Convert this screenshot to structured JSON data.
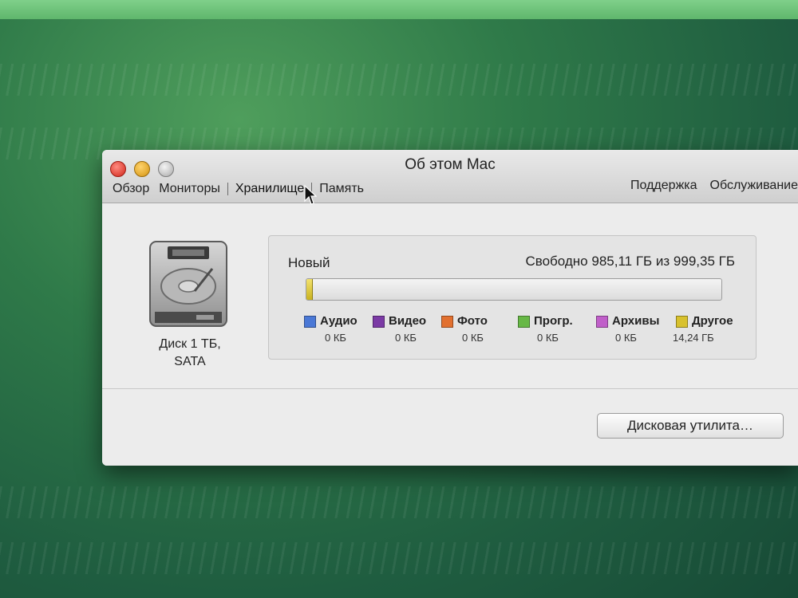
{
  "window": {
    "title": "Об этом Mac",
    "tabs": [
      {
        "label": "Обзор"
      },
      {
        "label": "Мониторы"
      },
      {
        "label": "Хранилище"
      },
      {
        "label": "Память"
      }
    ],
    "right_links": {
      "support": "Поддержка",
      "service": "Обслуживание"
    }
  },
  "disk": {
    "icon": "hard-drive-icon",
    "label_line1": "Диск 1 ТБ,",
    "label_line2": "SATA"
  },
  "storage": {
    "volume_name": "Новый",
    "free_text": "Свободно 985,11 ГБ из 999,35 ГБ",
    "used_fraction": 0.014,
    "categories": [
      {
        "name": "Аудио",
        "size": "0 КБ",
        "color": "#4a78d6"
      },
      {
        "name": "Видео",
        "size": "0 КБ",
        "color": "#7b3aa5"
      },
      {
        "name": "Фото",
        "size": "0 КБ",
        "color": "#e2702f"
      },
      {
        "name": "Прогр.",
        "size": "0 КБ",
        "color": "#67b846"
      },
      {
        "name": "Архивы",
        "size": "0 КБ",
        "color": "#c05fc9"
      },
      {
        "name": "Другое",
        "size": "14,24 ГБ",
        "color": "#d8c12d"
      }
    ]
  },
  "buttons": {
    "disk_utility": "Дисковая утилита…"
  }
}
